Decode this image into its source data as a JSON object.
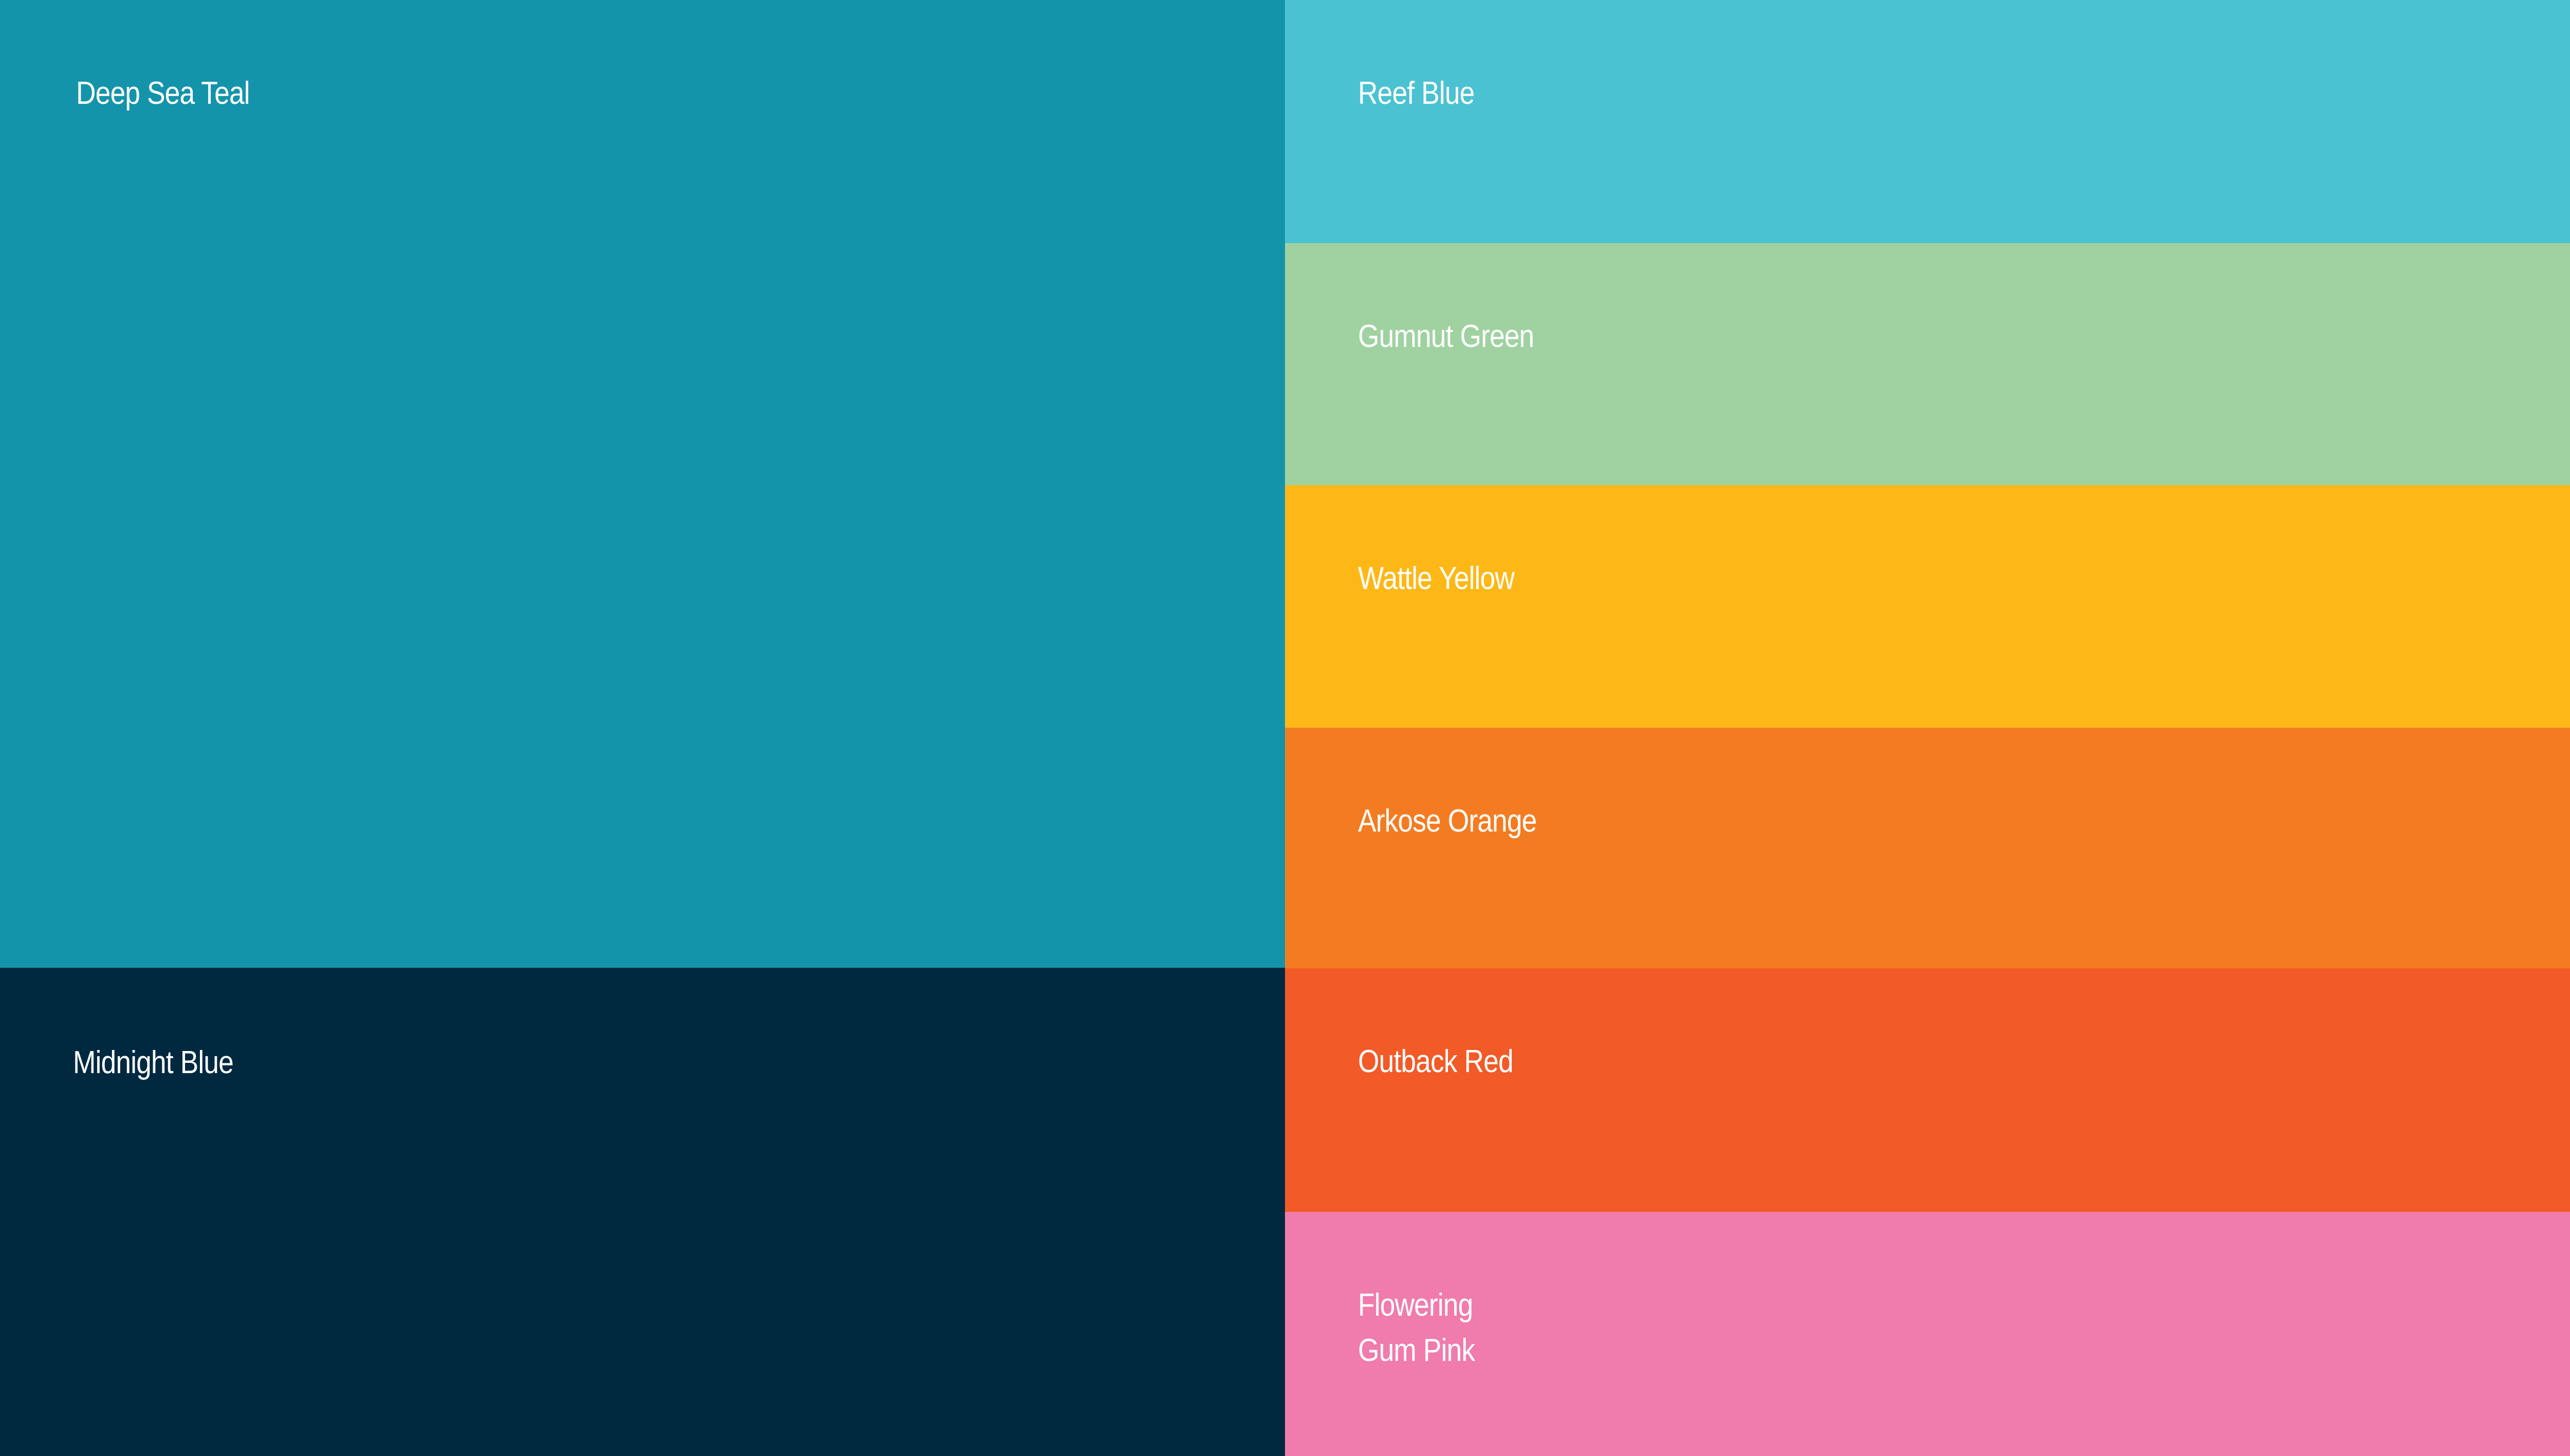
{
  "swatches": {
    "deep_sea_teal": {
      "label": "Deep Sea Teal",
      "color": "#1494AA"
    },
    "midnight_blue": {
      "label": "Midnight Blue",
      "color": "#002940"
    },
    "reef_blue": {
      "label": "Reef Blue",
      "color": "#4AC2D2"
    },
    "gumnut_green": {
      "label": "Gumnut Green",
      "color": "#9FD2A0"
    },
    "wattle_yellow": {
      "label": "Wattle Yellow",
      "color": "#FDB817"
    },
    "arkose_orange": {
      "label": "Arkose Orange",
      "color": "#F37C22"
    },
    "outback_red": {
      "label": "Outback Red",
      "color": "#F25A27"
    },
    "flowering_gum_pink": {
      "label_line1": "Flowering",
      "label_line2": "Gum Pink",
      "color": "#EF7CAC"
    }
  }
}
